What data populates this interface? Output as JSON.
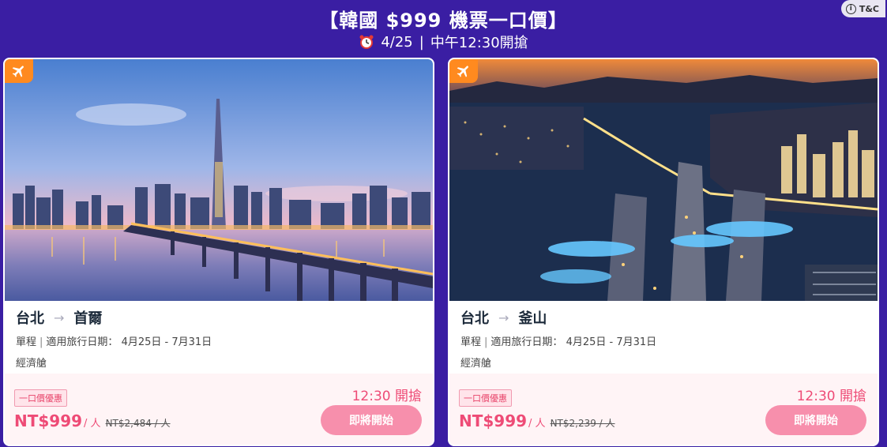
{
  "header": {
    "title": "【韓國 $999 機票一口價】",
    "date": "4/25",
    "divider": "|",
    "time": "中午12:30開搶",
    "tc_label": "T&C"
  },
  "colors": {
    "background": "#3a1ea3",
    "accent_pink": "#ee4b76",
    "button_pink": "#f78fac",
    "badge_orange": "#ff8a1f"
  },
  "cards": [
    {
      "origin": "台北",
      "destination": "首爾",
      "trip_type": "單程",
      "travel_dates_label": "適用旅行日期：",
      "travel_dates": "4月25日 - 7月31日",
      "cabin": "經濟艙",
      "promo_tag": "一口價優惠",
      "price": "NT$999",
      "per_person": "/ 人",
      "original_price": "NT$2,484 / 人",
      "sale_time": "12:30 開搶",
      "button_label": "即將開始",
      "image_icon": "airplane-icon"
    },
    {
      "origin": "台北",
      "destination": "釜山",
      "trip_type": "單程",
      "travel_dates_label": "適用旅行日期：",
      "travel_dates": "4月25日 - 7月31日",
      "cabin": "經濟艙",
      "promo_tag": "一口價優惠",
      "price": "NT$999",
      "per_person": "/ 人",
      "original_price": "NT$2,239 / 人",
      "sale_time": "12:30 開搶",
      "button_label": "即將開始",
      "image_icon": "airplane-icon"
    }
  ]
}
